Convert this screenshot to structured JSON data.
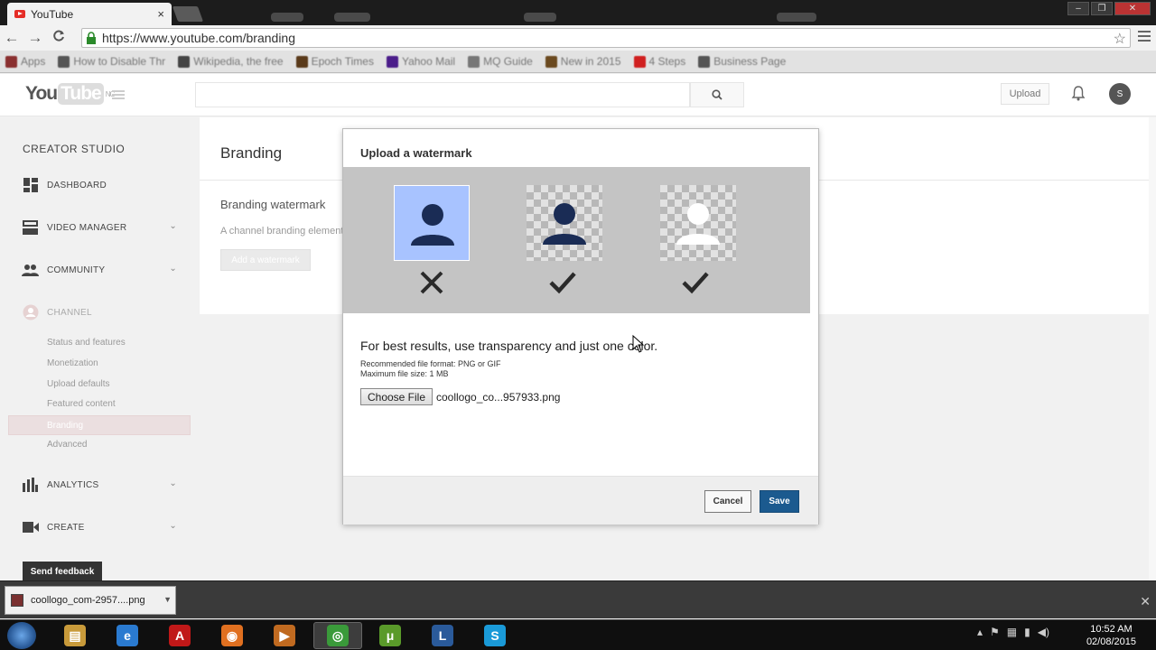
{
  "browser": {
    "tab_title": "YouTube",
    "tab_close": "×",
    "url": "https://www.youtube.com/branding",
    "back": "←",
    "forward": "→",
    "reload": "C",
    "star": "☆",
    "window_minimize": "–",
    "window_maximize": "❐",
    "window_close": "✕"
  },
  "bookmarks": [
    {
      "label": "Apps",
      "color": "#8a3030"
    },
    {
      "label": "How to Disable Thr",
      "color": "#555555"
    },
    {
      "label": "Wikipedia, the free",
      "color": "#444444"
    },
    {
      "label": "Epoch Times",
      "color": "#5a3a1a"
    },
    {
      "label": "Yahoo Mail",
      "color": "#4b1d8a"
    },
    {
      "label": "MQ Guide",
      "color": "#777777"
    },
    {
      "label": "New in 2015",
      "color": "#6b4a20"
    },
    {
      "label": "4 Steps",
      "color": "#d02020"
    },
    {
      "label": "Business Page",
      "color": "#555555"
    }
  ],
  "youtube": {
    "logo_you": "You",
    "logo_tube": "Tube",
    "logo_region": "NG",
    "upload_label": "Upload",
    "avatar_initial": "S"
  },
  "sidebar": {
    "title": "CREATOR STUDIO",
    "items": [
      {
        "label": "DASHBOARD",
        "icon": "dashboard-icon"
      },
      {
        "label": "VIDEO MANAGER",
        "icon": "video-manager-icon"
      },
      {
        "label": "COMMUNITY",
        "icon": "community-icon"
      },
      {
        "label": "CHANNEL",
        "icon": "channel-icon"
      },
      {
        "label": "ANALYTICS",
        "icon": "analytics-icon"
      },
      {
        "label": "CREATE",
        "icon": "create-icon"
      }
    ],
    "channel_subitems": [
      "Status and features",
      "Monetization",
      "Upload defaults",
      "Featured content",
      "Branding",
      "Advanced"
    ],
    "feedback_label": "Send feedback"
  },
  "main": {
    "page_title": "Branding",
    "section_title": "Branding watermark",
    "section_desc": "A channel branding element",
    "add_button": "Add a watermark"
  },
  "modal": {
    "title": "Upload a watermark",
    "best_results": "For best results, use transparency and just one color.",
    "format_line": "Recommended file format: PNG or GIF",
    "size_line": "Maximum file size: 1 MB",
    "choose_file": "Choose File",
    "file_name": "coollogo_co...957933.png",
    "cancel": "Cancel",
    "save": "Save",
    "examples": [
      {
        "background": "solid",
        "figure_color": "#1a2c55",
        "verdict": "wrong"
      },
      {
        "background": "transparent",
        "figure_color": "#1a2c55",
        "verdict": "correct"
      },
      {
        "background": "transparent",
        "figure_color": "#ffffff",
        "verdict": "correct"
      }
    ]
  },
  "download": {
    "file_label": "coollogo_com-2957....png"
  },
  "taskbar": {
    "apps": [
      {
        "name": "file-explorer",
        "glyph": "▤",
        "color": "#c89a3a"
      },
      {
        "name": "internet-explorer",
        "glyph": "e",
        "color": "#2a7ad0"
      },
      {
        "name": "adobe-reader",
        "glyph": "A",
        "color": "#c01818"
      },
      {
        "name": "firefox",
        "glyph": "◉",
        "color": "#e07020"
      },
      {
        "name": "media-player",
        "glyph": "▶",
        "color": "#c06a20"
      },
      {
        "name": "chrome",
        "glyph": "◎",
        "color": "#3a9a3a"
      },
      {
        "name": "utorrent",
        "glyph": "μ",
        "color": "#5a9a2a"
      },
      {
        "name": "lync",
        "glyph": "L",
        "color": "#2a5a9a"
      },
      {
        "name": "skype",
        "glyph": "S",
        "color": "#1a9ad8"
      }
    ],
    "time": "10:52 AM",
    "date": "02/08/2015"
  }
}
